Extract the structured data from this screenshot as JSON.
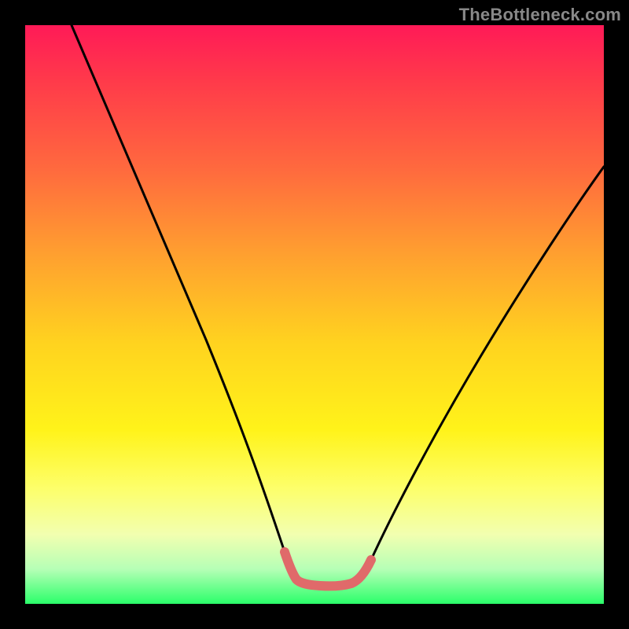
{
  "watermark": "TheBottleneck.com",
  "colors": {
    "frame": "#000000",
    "gradient_stops": [
      "#ff1a57",
      "#ff3b4a",
      "#ff6a3e",
      "#ffa12f",
      "#ffd31f",
      "#fff31a",
      "#fdff6a",
      "#f2ffb0",
      "#b6ffb6",
      "#2bff6a"
    ],
    "curve": "#000000",
    "flat_accent": "#e06a6a"
  },
  "chart_data": {
    "type": "line",
    "title": "",
    "xlabel": "",
    "ylabel": "",
    "xlim": [
      0,
      100
    ],
    "ylim": [
      0,
      100
    ],
    "grid": false,
    "legend": false,
    "annotations": [],
    "series": [
      {
        "name": "bottleneck-curve",
        "x": [
          8,
          12,
          16,
          20,
          24,
          28,
          32,
          36,
          40,
          42.5,
          45.5,
          50,
          55,
          56.5,
          58,
          61,
          65,
          69,
          73,
          78,
          84,
          90,
          97,
          100
        ],
        "y": [
          100,
          92,
          84,
          75,
          66,
          56,
          46,
          35,
          24,
          16,
          8,
          3.5,
          3.3,
          3.3,
          4.2,
          8.5,
          15,
          22,
          29,
          36,
          44,
          51,
          59,
          62
        ]
      },
      {
        "name": "flat-minimum",
        "x": [
          45.5,
          47,
          49,
          51,
          53,
          55,
          56.5
        ],
        "y": [
          8,
          5,
          3.6,
          3.3,
          3.4,
          3.8,
          5.2
        ]
      }
    ]
  }
}
